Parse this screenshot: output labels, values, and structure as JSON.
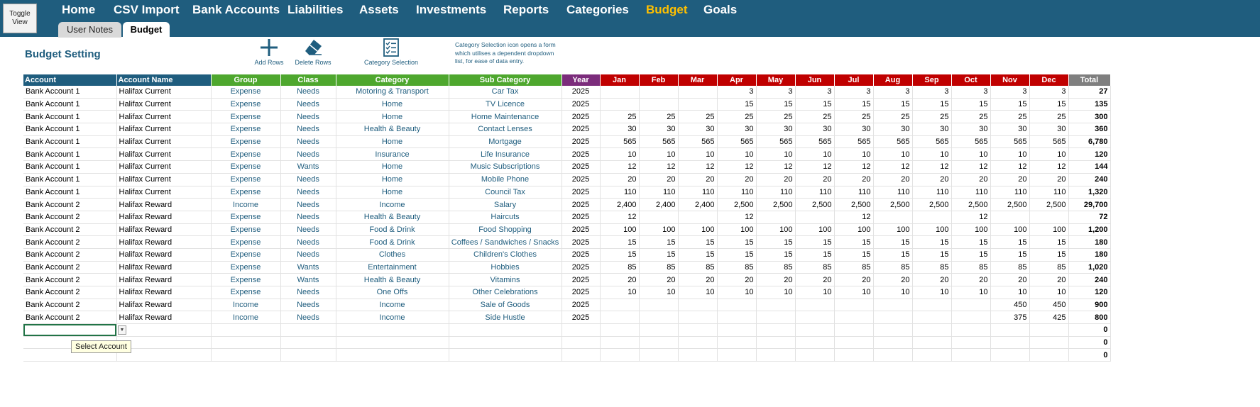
{
  "toggle_view": "Toggle\nView",
  "nav": [
    {
      "label": "Home",
      "active": false
    },
    {
      "label": "CSV Import",
      "active": false
    },
    {
      "label": "Bank Accounts",
      "active": false
    },
    {
      "label": "Liabilities",
      "active": false
    },
    {
      "label": "Assets",
      "active": false
    },
    {
      "label": "Investments",
      "active": false
    },
    {
      "label": "Reports",
      "active": false
    },
    {
      "label": "Categories",
      "active": false
    },
    {
      "label": "Budget",
      "active": true
    },
    {
      "label": "Goals",
      "active": false
    }
  ],
  "subtabs": [
    {
      "label": "User Notes",
      "active": false
    },
    {
      "label": "Budget",
      "active": true
    }
  ],
  "title": "Budget Setting",
  "tools": {
    "add_rows": "Add Rows",
    "delete_rows": "Delete Rows",
    "category_selection": "Category Selection"
  },
  "note": "Category Selection icon opens a form which utilises a dependent dropdown list, for ease of data entry.",
  "columns": [
    "Account",
    "Account Name",
    "Group",
    "Class",
    "Category",
    "Sub Category",
    "Year",
    "Jan",
    "Feb",
    "Mar",
    "Apr",
    "May",
    "Jun",
    "Jul",
    "Aug",
    "Sep",
    "Oct",
    "Nov",
    "Dec",
    "Total"
  ],
  "rows": [
    [
      "Bank Account 1",
      "Halifax Current",
      "Expense",
      "Needs",
      "Motoring & Transport",
      "Car Tax",
      "2025",
      "",
      "",
      "",
      "3",
      "3",
      "3",
      "3",
      "3",
      "3",
      "3",
      "3",
      "3",
      "27"
    ],
    [
      "Bank Account 1",
      "Halifax Current",
      "Expense",
      "Needs",
      "Home",
      "TV Licence",
      "2025",
      "",
      "",
      "",
      "15",
      "15",
      "15",
      "15",
      "15",
      "15",
      "15",
      "15",
      "15",
      "135"
    ],
    [
      "Bank Account 1",
      "Halifax Current",
      "Expense",
      "Needs",
      "Home",
      "Home Maintenance",
      "2025",
      "25",
      "25",
      "25",
      "25",
      "25",
      "25",
      "25",
      "25",
      "25",
      "25",
      "25",
      "25",
      "300"
    ],
    [
      "Bank Account 1",
      "Halifax Current",
      "Expense",
      "Needs",
      "Health & Beauty",
      "Contact Lenses",
      "2025",
      "30",
      "30",
      "30",
      "30",
      "30",
      "30",
      "30",
      "30",
      "30",
      "30",
      "30",
      "30",
      "360"
    ],
    [
      "Bank Account 1",
      "Halifax Current",
      "Expense",
      "Needs",
      "Home",
      "Mortgage",
      "2025",
      "565",
      "565",
      "565",
      "565",
      "565",
      "565",
      "565",
      "565",
      "565",
      "565",
      "565",
      "565",
      "6,780"
    ],
    [
      "Bank Account 1",
      "Halifax Current",
      "Expense",
      "Needs",
      "Insurance",
      "Life Insurance",
      "2025",
      "10",
      "10",
      "10",
      "10",
      "10",
      "10",
      "10",
      "10",
      "10",
      "10",
      "10",
      "10",
      "120"
    ],
    [
      "Bank Account 1",
      "Halifax Current",
      "Expense",
      "Wants",
      "Home",
      "Music Subscriptions",
      "2025",
      "12",
      "12",
      "12",
      "12",
      "12",
      "12",
      "12",
      "12",
      "12",
      "12",
      "12",
      "12",
      "144"
    ],
    [
      "Bank Account 1",
      "Halifax Current",
      "Expense",
      "Needs",
      "Home",
      "Mobile Phone",
      "2025",
      "20",
      "20",
      "20",
      "20",
      "20",
      "20",
      "20",
      "20",
      "20",
      "20",
      "20",
      "20",
      "240"
    ],
    [
      "Bank Account 1",
      "Halifax Current",
      "Expense",
      "Needs",
      "Home",
      "Council Tax",
      "2025",
      "110",
      "110",
      "110",
      "110",
      "110",
      "110",
      "110",
      "110",
      "110",
      "110",
      "110",
      "110",
      "1,320"
    ],
    [
      "Bank Account 2",
      "Halifax Reward",
      "Income",
      "Needs",
      "Income",
      "Salary",
      "2025",
      "2,400",
      "2,400",
      "2,400",
      "2,500",
      "2,500",
      "2,500",
      "2,500",
      "2,500",
      "2,500",
      "2,500",
      "2,500",
      "2,500",
      "29,700"
    ],
    [
      "Bank Account 2",
      "Halifax Reward",
      "Expense",
      "Needs",
      "Health & Beauty",
      "Haircuts",
      "2025",
      "12",
      "",
      "",
      "12",
      "",
      "",
      "12",
      "",
      "",
      "12",
      "",
      "",
      "72"
    ],
    [
      "Bank Account 2",
      "Halifax Reward",
      "Expense",
      "Needs",
      "Food & Drink",
      "Food Shopping",
      "2025",
      "100",
      "100",
      "100",
      "100",
      "100",
      "100",
      "100",
      "100",
      "100",
      "100",
      "100",
      "100",
      "1,200"
    ],
    [
      "Bank Account 2",
      "Halifax Reward",
      "Expense",
      "Needs",
      "Food & Drink",
      "Coffees / Sandwiches / Snacks",
      "2025",
      "15",
      "15",
      "15",
      "15",
      "15",
      "15",
      "15",
      "15",
      "15",
      "15",
      "15",
      "15",
      "180"
    ],
    [
      "Bank Account 2",
      "Halifax Reward",
      "Expense",
      "Needs",
      "Clothes",
      "Children's Clothes",
      "2025",
      "15",
      "15",
      "15",
      "15",
      "15",
      "15",
      "15",
      "15",
      "15",
      "15",
      "15",
      "15",
      "180"
    ],
    [
      "Bank Account 2",
      "Halifax Reward",
      "Expense",
      "Wants",
      "Entertainment",
      "Hobbies",
      "2025",
      "85",
      "85",
      "85",
      "85",
      "85",
      "85",
      "85",
      "85",
      "85",
      "85",
      "85",
      "85",
      "1,020"
    ],
    [
      "Bank Account 2",
      "Halifax Reward",
      "Expense",
      "Wants",
      "Health & Beauty",
      "Vitamins",
      "2025",
      "20",
      "20",
      "20",
      "20",
      "20",
      "20",
      "20",
      "20",
      "20",
      "20",
      "20",
      "20",
      "240"
    ],
    [
      "Bank Account 2",
      "Halifax Reward",
      "Expense",
      "Needs",
      "One Offs",
      "Other Celebrations",
      "2025",
      "10",
      "10",
      "10",
      "10",
      "10",
      "10",
      "10",
      "10",
      "10",
      "10",
      "10",
      "10",
      "120"
    ],
    [
      "Bank Account 2",
      "Halifax Reward",
      "Income",
      "Needs",
      "Income",
      "Sale of Goods",
      "2025",
      "",
      "",
      "",
      "",
      "",
      "",
      "",
      "",
      "",
      "",
      "450",
      "450",
      "900"
    ],
    [
      "Bank Account 2",
      "Halifax Reward",
      "Income",
      "Needs",
      "Income",
      "Side Hustle",
      "2025",
      "",
      "",
      "",
      "",
      "",
      "",
      "",
      "",
      "",
      "",
      "375",
      "425",
      "800"
    ],
    [
      "",
      "",
      "",
      "",
      "",
      "",
      "",
      "",
      "",
      "",
      "",
      "",
      "",
      "",
      "",
      "",
      "",
      "",
      "",
      "0"
    ],
    [
      "",
      "",
      "",
      "",
      "",
      "",
      "",
      "",
      "",
      "",
      "",
      "",
      "",
      "",
      "",
      "",
      "",
      "",
      "",
      "0"
    ],
    [
      "",
      "",
      "",
      "",
      "",
      "",
      "",
      "",
      "",
      "",
      "",
      "",
      "",
      "",
      "",
      "",
      "",
      "",
      "",
      "0"
    ]
  ],
  "tooltip": "Select Account",
  "colors": {
    "nav_bg": "#1f5d7e",
    "nav_active": "#ffc000",
    "header_green": "#4ea72e",
    "header_purple": "#7b2c7b",
    "header_red": "#c00000",
    "header_gray": "#7f7f7f"
  }
}
